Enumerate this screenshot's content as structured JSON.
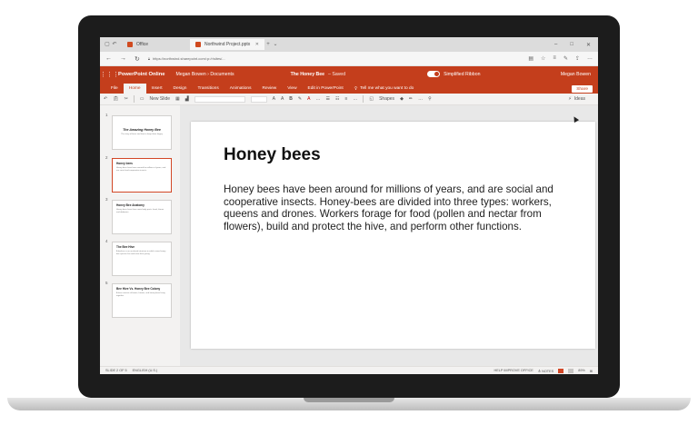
{
  "browser": {
    "tabs": [
      {
        "label": "Office"
      },
      {
        "label": "Northwind Project.pptx",
        "active": true
      }
    ],
    "url": "https://northwind.sharepoint.com/:p:/r/sites/..."
  },
  "app": {
    "name": "PowerPoint Online",
    "breadcrumb": "Megan Bowen › Documents",
    "doc_title": "The Honey Bee",
    "doc_status": "–  Saved",
    "simplified_ribbon_label": "Simplified Ribbon",
    "user": "Megan Bowen",
    "accent": "#c43e1c"
  },
  "ribbon": {
    "tabs": [
      "File",
      "Home",
      "Insert",
      "Design",
      "Transitions",
      "Animations",
      "Review",
      "View",
      "Edit in PowerPoint"
    ],
    "tell_me": "Tell me what you want to do",
    "share": "Share"
  },
  "toolbar": {
    "new_slide": "New Slide",
    "shapes": "Shapes",
    "ideas": "Ideas"
  },
  "thumbnails": [
    {
      "num": "1",
      "title": "The Amazing Honey Bee",
      "text": "The story of bees and how to keep them happy"
    },
    {
      "num": "2",
      "title": "Honey bees",
      "text": "Honey bees have been around for millions of years, and are social and cooperative insects."
    },
    {
      "num": "3",
      "title": "Honey Bee Anatomy",
      "text": "Honey bees have three main body parts: head, thorax and abdomen"
    },
    {
      "num": "4",
      "title": "The Bee Hive",
      "text": "A beehive is an enclosed structure in which some honey bee species live and raise their young."
    },
    {
      "num": "5",
      "title": "Bee Hive Vs. Honey Bee Colony",
      "text": "A hive consists of boxes, frames, and honey bees living together."
    }
  ],
  "slide": {
    "title": "Honey bees",
    "body": "Honey bees have been around for millions of years, and are social and cooperative insects. Honey-bees are divided into three types: workers, queens and drones. Workers forage for food (pollen and nectar from flowers), build and protect the hive, and perform other functions."
  },
  "status": {
    "slide_of": "SLIDE 2 OF 5",
    "language": "ENGLISH (U.S.)",
    "help": "HELP IMPROVE OFFICE",
    "notes": "NOTES",
    "zoom": "89%"
  }
}
